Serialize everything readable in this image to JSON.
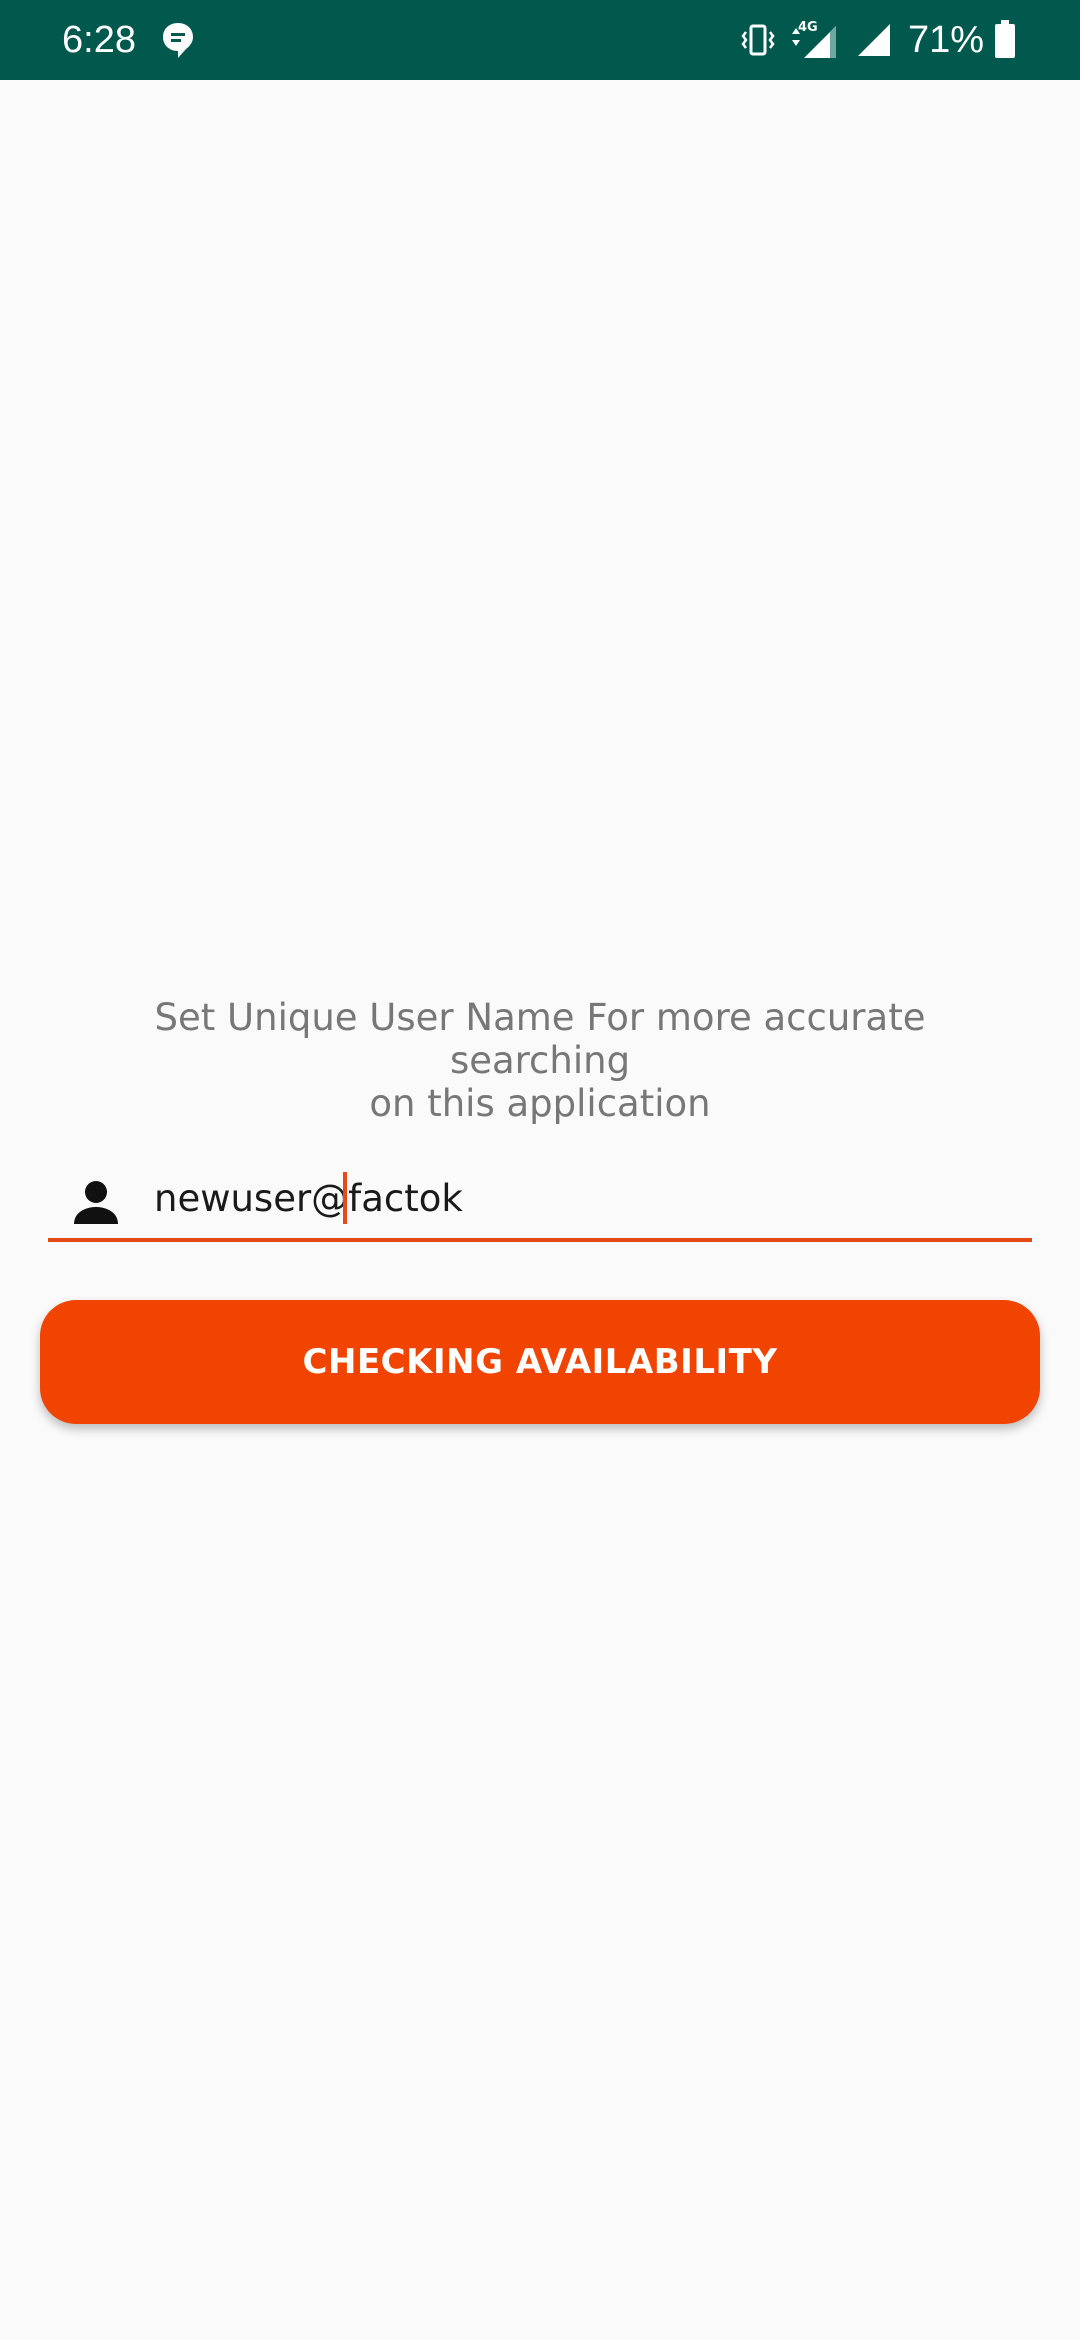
{
  "status_bar": {
    "time": "6:28",
    "network_label": "4G",
    "battery_percent": "71%",
    "background_color": "#00594c",
    "icons": [
      "message-icon",
      "vibrate-icon",
      "signal-4g-icon",
      "signal-icon",
      "battery-icon"
    ]
  },
  "main": {
    "description_line1": "Set Unique User Name For more accurate searching",
    "description_line2": "on this application",
    "username_value": "newuser@factok",
    "username_icon": "person-icon",
    "button_label": "CHECKING AVAILABILITY",
    "accent_color": "#f04400"
  }
}
